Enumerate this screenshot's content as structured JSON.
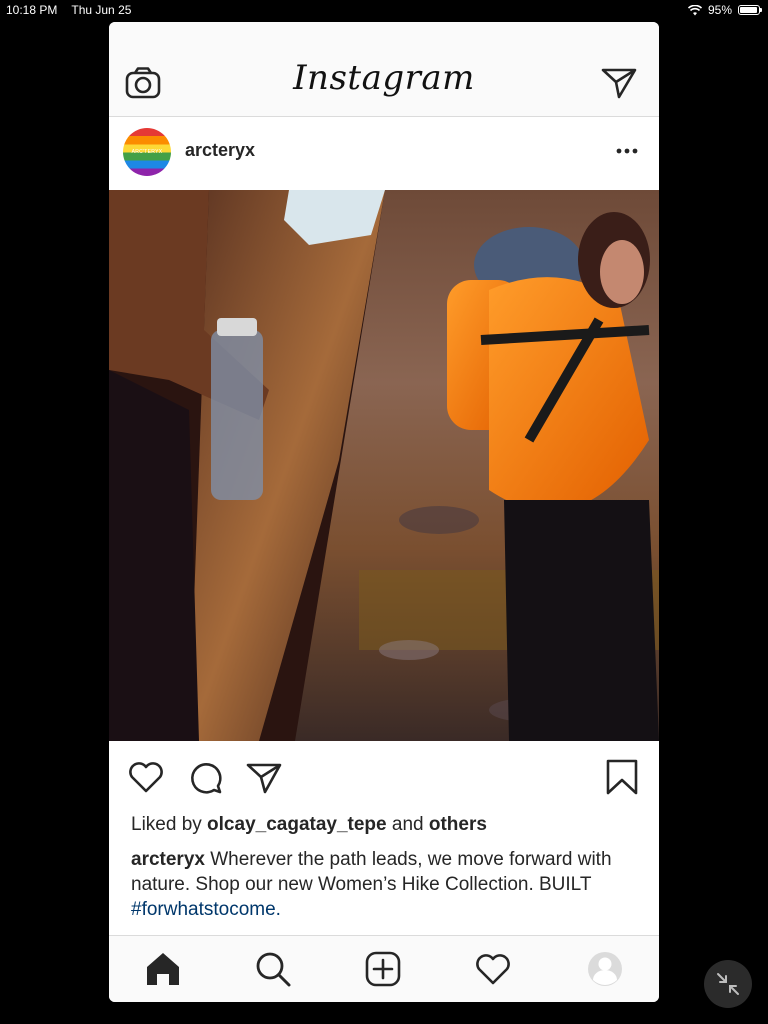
{
  "status": {
    "time": "10:18 PM",
    "date": "Thu Jun 25",
    "battery": "95%",
    "battery_level": 0.95
  },
  "app": {
    "logo": "Instagram"
  },
  "post": {
    "username": "arcteryx",
    "avatar_text": "ARC'TERYX",
    "liked_prefix": "Liked by ",
    "liked_user": "olcay_cagatay_tepe",
    "liked_middle": " and ",
    "liked_others": "others",
    "caption_user": "arcteryx",
    "caption_text": " Wherever the path leads, we move forward with nature. Shop our new Women’s Hike Collection. BUILT ",
    "hashtag": "#forwhatstocome."
  },
  "icons": {
    "camera": "camera-icon",
    "direct": "paper-plane-icon",
    "more": "more-dots-icon",
    "like": "heart-icon",
    "comment": "comment-icon",
    "share": "paper-plane-icon",
    "save": "bookmark-icon",
    "home": "home-icon",
    "search": "search-icon",
    "new_post": "plus-square-icon",
    "activity": "heart-icon",
    "profile": "profile-icon",
    "collapse": "collapse-icon"
  },
  "colors": {
    "text": "#262626",
    "hashtag": "#00376b",
    "jacket": "#f57c00",
    "background": "#000000"
  }
}
